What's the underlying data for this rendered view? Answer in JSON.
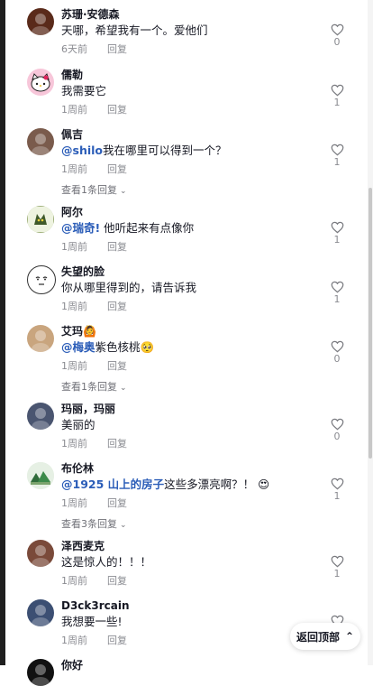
{
  "comments": [
    {
      "name": "苏珊·安德森",
      "segments": [
        {
          "t": "text",
          "v": "天哪，希望我有一个。爱他们"
        }
      ],
      "time": "6天前",
      "reply": "回复",
      "likes": "0",
      "replies": "",
      "avatar_color": "#5a2a1a",
      "avatar_icon": "portrait-avatar"
    },
    {
      "name": "儒勒",
      "segments": [
        {
          "t": "text",
          "v": "我需要它"
        }
      ],
      "time": "1周前",
      "reply": "回复",
      "likes": "1",
      "replies": "",
      "avatar_color": "#f7c6d9",
      "avatar_icon": "hello-kitty-avatar"
    },
    {
      "name": "佩吉",
      "segments": [
        {
          "t": "mention",
          "v": "@shilo"
        },
        {
          "t": "text",
          "v": "我在哪里可以得到一个？"
        }
      ],
      "time": "1周前",
      "reply": "回复",
      "likes": "1",
      "replies": "查看1条回复",
      "avatar_color": "#7a5b4c",
      "avatar_icon": "portrait-avatar"
    },
    {
      "name": "阿尔",
      "segments": [
        {
          "t": "mention",
          "v": "@瑞奇!"
        },
        {
          "t": "text",
          "v": " 他听起来有点像你"
        }
      ],
      "time": "1周前",
      "reply": "回复",
      "likes": "1",
      "replies": "",
      "avatar_color": "#9fb07a",
      "avatar_icon": "creature-avatar"
    },
    {
      "name": "失望的脸",
      "segments": [
        {
          "t": "text",
          "v": "你从哪里得到的，请告诉我"
        }
      ],
      "time": "1周前",
      "reply": "回复",
      "likes": "1",
      "replies": "",
      "avatar_color": "#ffffff",
      "avatar_icon": "disappointed-face-avatar"
    },
    {
      "name": "艾玛🙆",
      "segments": [
        {
          "t": "mention",
          "v": "@梅奥"
        },
        {
          "t": "text",
          "v": "紫色核桃🥺"
        }
      ],
      "time": "1周前",
      "reply": "回复",
      "likes": "0",
      "replies": "查看1条回复",
      "avatar_color": "#c9a57e",
      "avatar_icon": "portrait-avatar"
    },
    {
      "name": "玛丽，玛丽",
      "segments": [
        {
          "t": "text",
          "v": "美丽的"
        }
      ],
      "time": "1周前",
      "reply": "回复",
      "likes": "0",
      "replies": "",
      "avatar_color": "#4a5570",
      "avatar_icon": "portrait-avatar"
    },
    {
      "name": "布伦林",
      "segments": [
        {
          "t": "mention",
          "v": "@1925 山上的房子"
        },
        {
          "t": "text",
          "v": "这些多漂亮啊？！ 😍"
        }
      ],
      "time": "1周前",
      "reply": "回复",
      "likes": "1",
      "replies": "查看3条回复",
      "avatar_color": "#e3efe2",
      "avatar_icon": "landscape-avatar"
    },
    {
      "name": "泽西麦克",
      "segments": [
        {
          "t": "text",
          "v": "这是惊人的！！！"
        }
      ],
      "time": "1周前",
      "reply": "回复",
      "likes": "1",
      "replies": "",
      "avatar_color": "#7a4a3a",
      "avatar_icon": "portrait-avatar"
    },
    {
      "name": "D3ck3rcain",
      "segments": [
        {
          "t": "text",
          "v": "我想要一些!"
        }
      ],
      "time": "1周前",
      "reply": "回复",
      "likes": "",
      "replies": "",
      "avatar_color": "#3c4f73",
      "avatar_icon": "portrait-avatar"
    },
    {
      "name": "你好",
      "segments": [],
      "time": "",
      "reply": "",
      "likes": "",
      "replies": "",
      "avatar_color": "#111111",
      "avatar_icon": "portrait-avatar"
    }
  ],
  "back_to_top": {
    "label": "返回顶部",
    "icon": "double-chevron-up-icon"
  }
}
